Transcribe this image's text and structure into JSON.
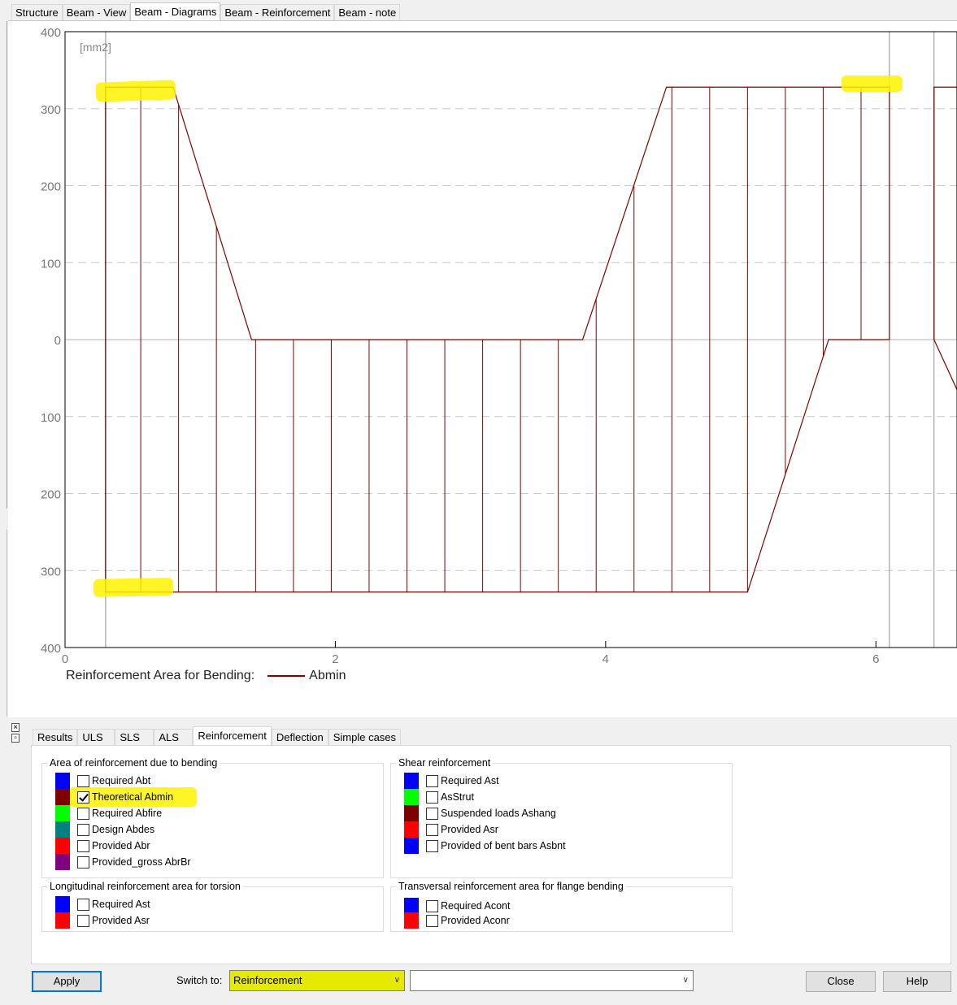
{
  "top_tabs": [
    "Structure",
    "Beam - View",
    "Beam - Diagrams",
    "Beam - Reinforcement",
    "Beam - note"
  ],
  "top_tab_active": 2,
  "chart_data": {
    "type": "line",
    "unit_label": "[mm2]",
    "legend_title": "Reinforcement Area for Bending:",
    "series": [
      {
        "name": "Abmin",
        "color": "#800000",
        "positive_envelope": {
          "x": [
            0.3,
            0.3,
            0.8,
            1.38,
            3.83,
            4.45,
            6.1,
            6.1
          ],
          "y": [
            0,
            328,
            328,
            0,
            0,
            328,
            328,
            0
          ]
        },
        "negative_envelope": {
          "x": [
            0.3,
            0.3,
            5.05,
            5.65,
            6.1
          ],
          "y": [
            0,
            -328,
            -328,
            0,
            0
          ]
        },
        "right_span": {
          "x": [
            6.43,
            6.43,
            6.6,
            6.6
          ],
          "y": [
            0,
            328,
            328,
            0
          ],
          "x_neg": [
            6.43,
            6.6
          ],
          "y_neg": [
            0,
            -65
          ]
        },
        "ordinates_x": [
          0.3,
          0.56,
          0.84,
          1.12,
          1.41,
          1.69,
          1.97,
          2.25,
          2.53,
          2.81,
          3.09,
          3.37,
          3.65,
          3.93,
          4.21,
          4.49,
          4.77,
          5.05,
          5.33,
          5.61,
          5.89,
          6.43
        ]
      }
    ],
    "xlim": [
      0,
      6.6
    ],
    "ylim": [
      -400,
      400
    ],
    "x_ticks": [
      0,
      2,
      4,
      6
    ],
    "y_ticks": [
      400,
      300,
      200,
      100,
      0,
      -100,
      -200,
      -300,
      -400
    ],
    "y_tick_labels": [
      "400",
      "300",
      "200",
      "100",
      "0",
      "100",
      "200",
      "300",
      "400"
    ],
    "x_tick_labels": [
      "0",
      "2",
      "4",
      "6"
    ],
    "support_lines_x": [
      0.3,
      6.1,
      6.43
    ],
    "grid": "dashed horizontal"
  },
  "bottom_tabs": [
    "Results",
    "ULS",
    "SLS",
    "ALS",
    "Reinforcement",
    "Deflection",
    "Simple cases"
  ],
  "bottom_tab_active": 4,
  "groups": {
    "bending": {
      "title": "Area of reinforcement due to bending",
      "items": [
        {
          "label": "Required Abt",
          "color": "#0000ff",
          "checked": false
        },
        {
          "label": "Theoretical Abmin",
          "color": "#800000",
          "checked": true
        },
        {
          "label": "Required Abfire",
          "color": "#00ff00",
          "checked": false
        },
        {
          "label": "Design Abdes",
          "color": "#008080",
          "checked": false
        },
        {
          "label": "Provided Abr",
          "color": "#ff0000",
          "checked": false
        },
        {
          "label": "Provided_gross AbrBr",
          "color": "#800080",
          "checked": false
        }
      ]
    },
    "shear": {
      "title": "Shear reinforcement",
      "items": [
        {
          "label": "Required Ast",
          "color": "#0000ff",
          "checked": false
        },
        {
          "label": "AsStrut",
          "color": "#00ff00",
          "checked": false
        },
        {
          "label": "Suspended loads Ashang",
          "color": "#800000",
          "checked": false
        },
        {
          "label": "Provided Asr",
          "color": "#ff0000",
          "checked": false
        },
        {
          "label": "Provided of bent bars Asbnt",
          "color": "#0000ff",
          "checked": false
        }
      ]
    },
    "torsion": {
      "title": "Longitudinal reinforcement area for torsion",
      "items": [
        {
          "label": "Required Ast",
          "color": "#0000ff",
          "checked": false
        },
        {
          "label": "Provided Asr",
          "color": "#ff0000",
          "checked": false
        }
      ]
    },
    "flange": {
      "title": "Transversal reinforcement area for flange bending",
      "items": [
        {
          "label": "Required Acont",
          "color": "#0000ff",
          "checked": false
        },
        {
          "label": "Provided Aconr",
          "color": "#ff0000",
          "checked": false
        }
      ]
    }
  },
  "footer": {
    "apply": "Apply",
    "switch_label": "Switch to:",
    "switch_value": "Reinforcement",
    "second_value": "",
    "close": "Close",
    "help": "Help"
  }
}
